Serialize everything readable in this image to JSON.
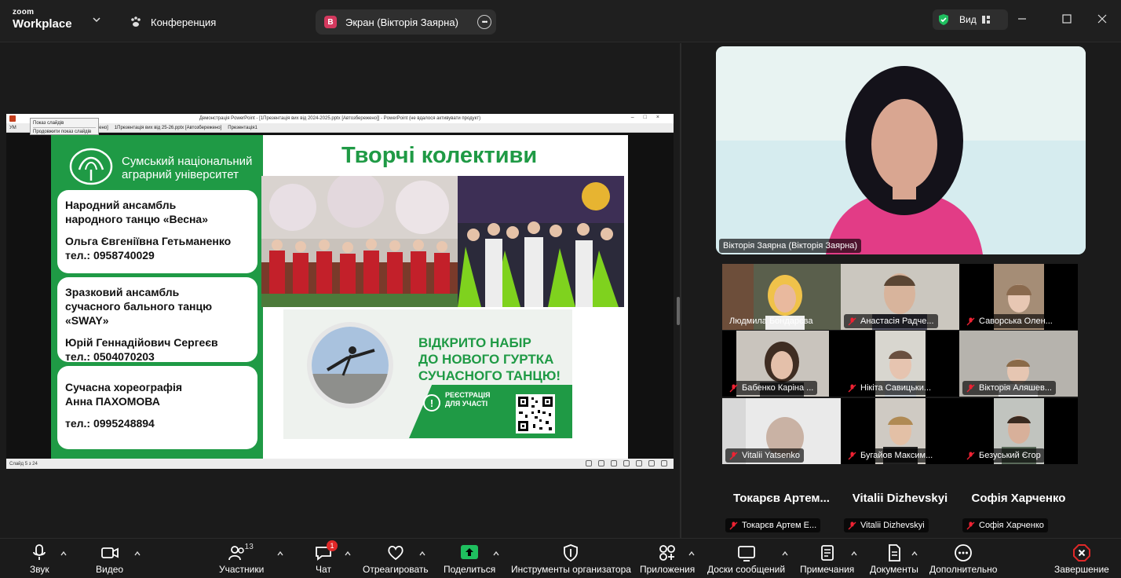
{
  "titlebar": {
    "logo_top": "zoom",
    "logo_bottom": "Workplace",
    "tab_conference": "Конференция",
    "tab_screen": "Экран (Вікторія Заярна)",
    "tab_screen_badge": "В",
    "view_label": "Вид"
  },
  "ppt": {
    "window_title": "Демонстрація PowerPoint - [1Презентація вих від 2024-2025.pptx [Автозбережено]] - PowerPoint (не вдалося активувати продукт)",
    "popup_item1": "Показ слайдів",
    "popup_item2": "Продовжити показ слайдів",
    "tabs": [
      "УМ",
      "бережено]",
      "1Презентація вих від 25-26.pptx [Автозбережено]",
      "Презентація1"
    ],
    "status_text": "Слайд 5 з 24"
  },
  "slide": {
    "uni_line1": "Сумський національний",
    "uni_line2": "аграрний університет",
    "heading": "Творчі колективи",
    "card1": [
      "Народний ансамбль",
      "народного танцю «Весна»",
      "Ольга Євгеніївна Гетьманенко",
      " тел.: 0958740029"
    ],
    "card2": [
      "Зразковий ансамбль",
      "сучасного бального танцю",
      "«SWAY»",
      "Юрій Геннадійович Сергеєв",
      "тел.: 0504070203"
    ],
    "card3": [
      "Сучасна хореографія",
      "Анна ПАХОМОВА",
      "тел.: 0995248894"
    ],
    "promo_lines": [
      "ВІДКРИТО НАБІР",
      "ДО НОВОГО ГУРТКА",
      "СУЧАСНОГО ТАНЦЮ!"
    ],
    "promo_reg1": "РЕЄСТРАЦІЯ",
    "promo_reg2": "ДЛЯ УЧАСТІ",
    "promo_mark": "!"
  },
  "speaker": {
    "name": "Вікторія Заярна (Вікторія Заярна)"
  },
  "participants": [
    {
      "name": "Людмила Бондарєва"
    },
    {
      "name": "Анастасія Радче..."
    },
    {
      "name": "Саворська Олен..."
    },
    {
      "name": "Бабенко Каріна ..."
    },
    {
      "name": "Нікіта Савицьки..."
    },
    {
      "name": "Вікторія Аляшев..."
    },
    {
      "name": "Vitalii Yatsenko"
    },
    {
      "name": "Бугайов Максим..."
    },
    {
      "name": "Безуський Єгор"
    }
  ],
  "name_tiles": [
    {
      "big": "Токарєв Артем...",
      "tag": "Токарєв Артем Е..."
    },
    {
      "big": "Vitalii Dizhevskyi",
      "tag": "Vitalii Dizhevskyi"
    },
    {
      "big": "Софія Харченко",
      "tag": "Софія Харченко"
    }
  ],
  "toolbar": {
    "audio": "Звук",
    "video": "Видео",
    "participants": "Участники",
    "participants_count": "13",
    "chat": "Чат",
    "chat_badge": "1",
    "react": "Отреагировать",
    "share": "Поделиться",
    "host_tools": "Инструменты организатора",
    "apps": "Приложения",
    "whiteboards": "Доски сообщений",
    "notes": "Примечания",
    "docs": "Документы",
    "more": "Дополнительно",
    "end": "Завершение"
  },
  "colors": {
    "accent_green": "#1f9a45",
    "end_red": "#e02828",
    "share_green": "#1fbf5f"
  }
}
